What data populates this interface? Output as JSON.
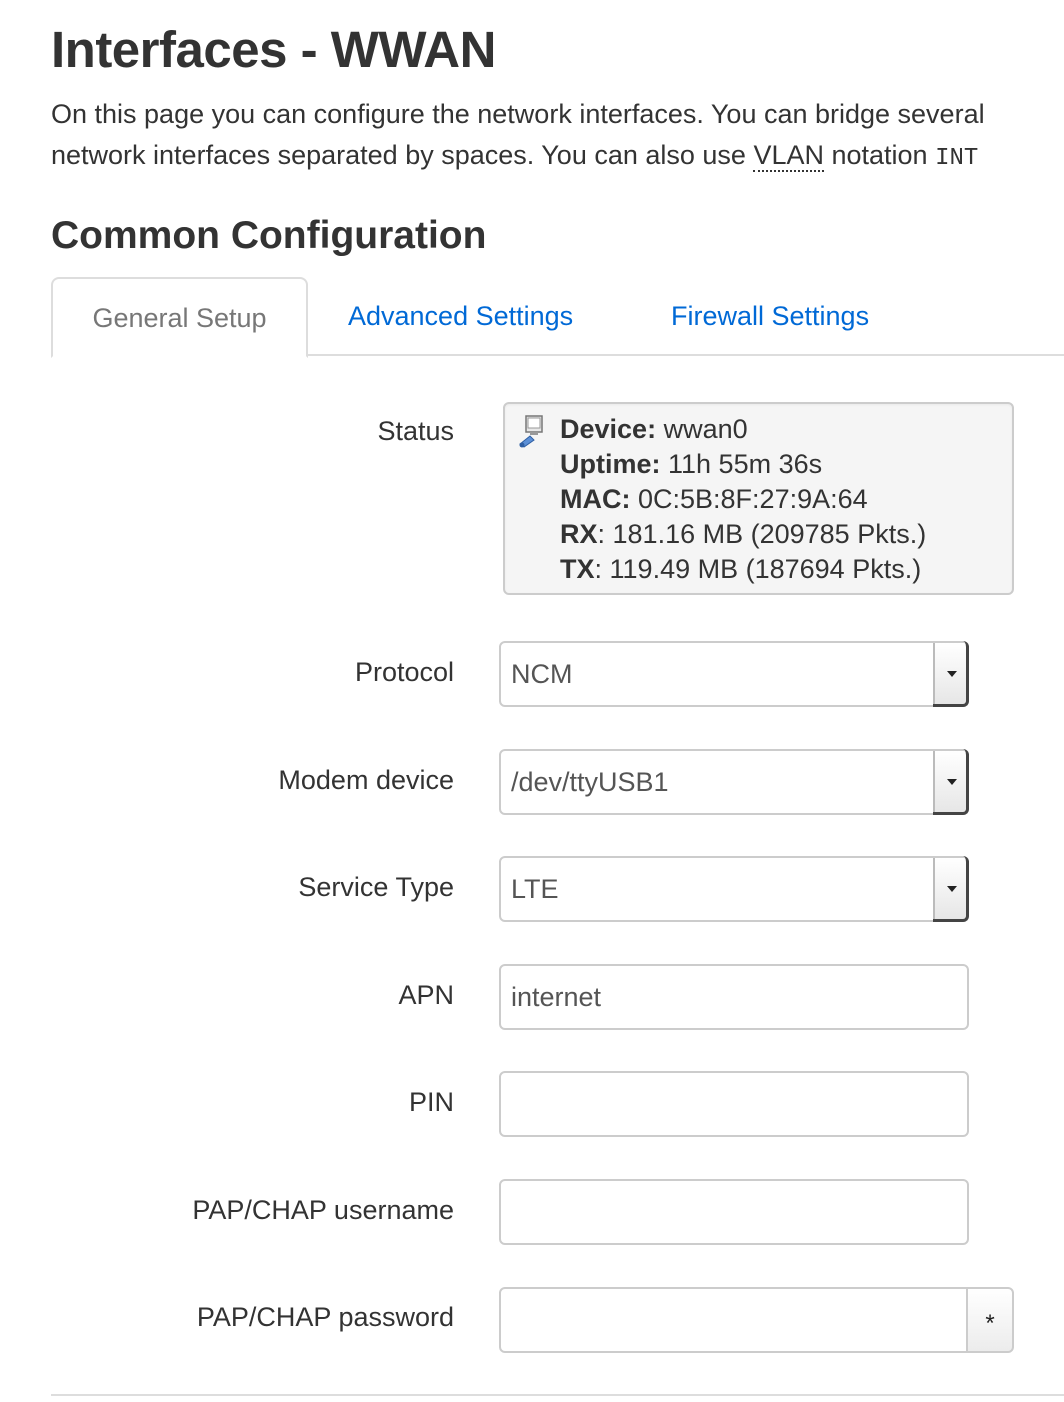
{
  "page": {
    "title": "Interfaces - WWAN",
    "description_line1": "On this page you can configure the network interfaces. You can bridge several",
    "description_line2_prefix": "network interfaces separated by spaces. You can also use ",
    "description_line2_abbr": "VLAN",
    "description_line2_middle": " notation ",
    "description_line2_code": "INT"
  },
  "section": {
    "title": "Common Configuration"
  },
  "tabs": [
    {
      "label": "General Setup",
      "active": true
    },
    {
      "label": "Advanced Settings",
      "active": false
    },
    {
      "label": "Firewall Settings",
      "active": false
    }
  ],
  "status": {
    "label": "Status",
    "icon": "network-interface-icon",
    "device_key": "Device:",
    "device_value": "wwan0",
    "uptime_key": "Uptime:",
    "uptime_value": "11h 55m 36s",
    "mac_key": "MAC:",
    "mac_value": "0C:5B:8F:27:9A:64",
    "rx_key": "RX",
    "rx_value": ": 181.16 MB (209785 Pkts.)",
    "tx_key": "TX",
    "tx_value": ": 119.49 MB (187694 Pkts.)"
  },
  "fields": {
    "protocol": {
      "label": "Protocol",
      "value": "NCM"
    },
    "modem_device": {
      "label": "Modem device",
      "value": "/dev/ttyUSB1"
    },
    "service_type": {
      "label": "Service Type",
      "value": "LTE"
    },
    "apn": {
      "label": "APN",
      "value": "internet"
    },
    "pin": {
      "label": "PIN",
      "value": ""
    },
    "pap_username": {
      "label": "PAP/CHAP username",
      "value": ""
    },
    "pap_password": {
      "label": "PAP/CHAP password",
      "value": "",
      "reveal_glyph": "*"
    }
  },
  "colors": {
    "link": "#0069d6",
    "text": "#333333",
    "border": "#cccccc"
  }
}
